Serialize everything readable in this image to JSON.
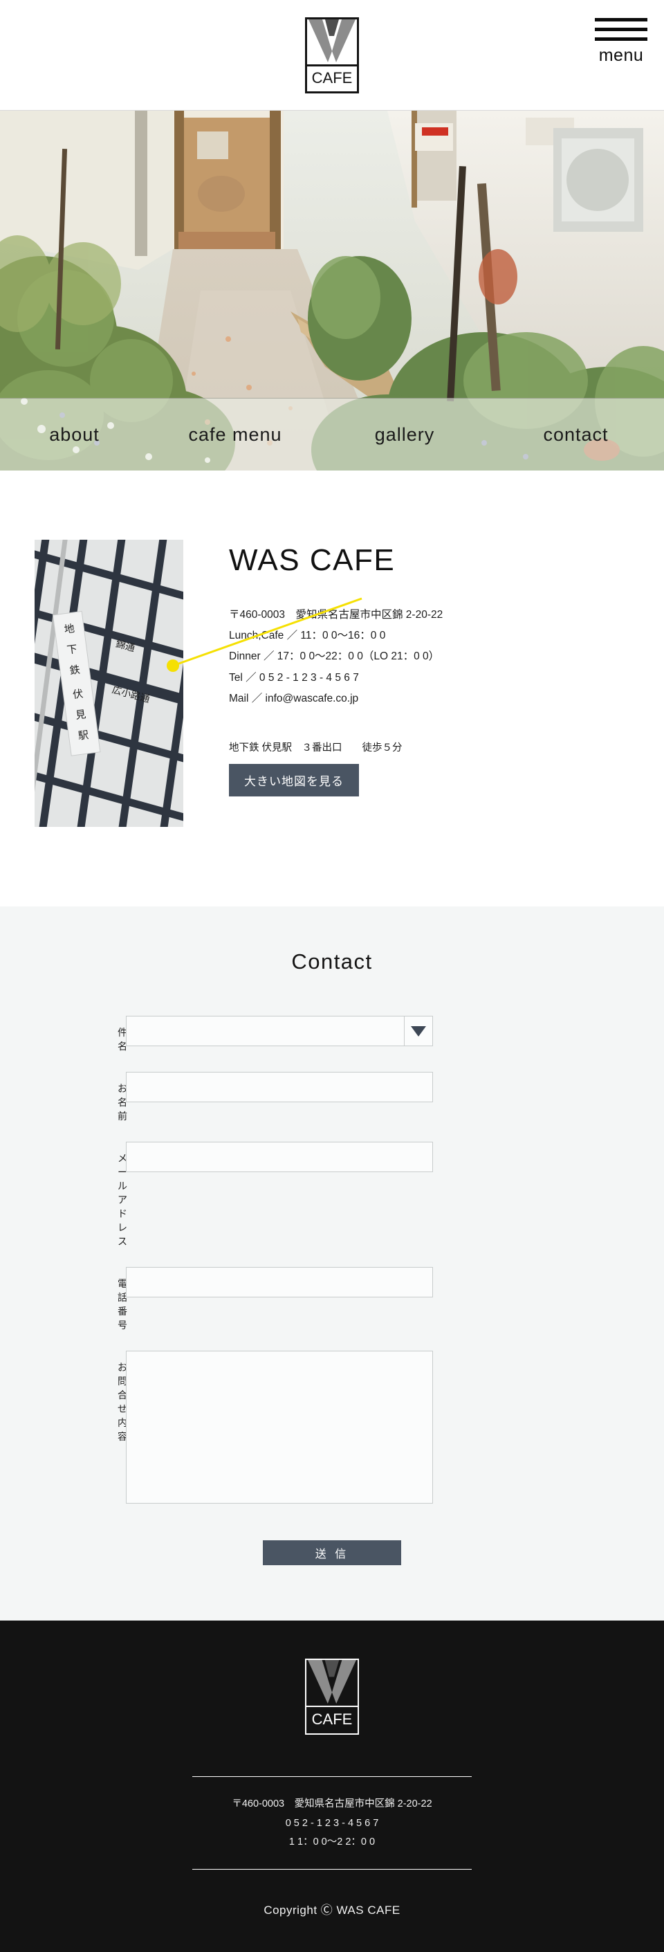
{
  "header": {
    "logo": {
      "mark": "W",
      "word": "CAFE",
      "name": "WAS CAFE logo"
    },
    "menu_button": {
      "label": "menu",
      "icon": "hamburger-icon"
    }
  },
  "hero": {
    "image_alt": "garden path leading to cafe entrance",
    "nav": [
      {
        "label": "about"
      },
      {
        "label": "cafe menu"
      },
      {
        "label": "gallery"
      },
      {
        "label": "contact"
      }
    ]
  },
  "map": {
    "station_label": "地下鉄 伏見駅",
    "street_labels": [
      "錦通",
      "広小路通"
    ],
    "marker_color": "#f5e003"
  },
  "info": {
    "title": "WAS CAFE",
    "lines": [
      "〒460-0003　愛知県名古屋市中区錦 2-20-22",
      "Lunch,Cafe ／ 11：0 0〜16：0 0",
      "Dinner ／ 17：0 0〜22：0 0（LO 21：0 0）",
      "Tel ／ 0 5 2 - 1 2 3 - 4 5 6 7",
      "Mail ／ info@wascafe.co.jp"
    ],
    "access": "地下鉄 伏見駅　３番出口　　徒歩５分",
    "map_button": "大きい地図を見る"
  },
  "contact": {
    "heading": "Contact",
    "fields": [
      {
        "label": "件名",
        "type": "select",
        "value": "",
        "placeholder": ""
      },
      {
        "label": "お名前",
        "type": "text",
        "value": "",
        "placeholder": ""
      },
      {
        "label": "メールアドレス",
        "type": "text",
        "value": "",
        "placeholder": ""
      },
      {
        "label": "電話番号",
        "type": "text",
        "value": "",
        "placeholder": ""
      },
      {
        "label": "お問合せ内容",
        "type": "textarea",
        "value": "",
        "placeholder": ""
      }
    ],
    "submit_label": "送 信"
  },
  "footer": {
    "logo": {
      "mark": "W",
      "word": "CAFE"
    },
    "info_lines": [
      "〒460-0003　愛知県名古屋市中区錦 2-20-22",
      "0 5 2 - 1 2 3 - 4 5 6 7",
      "1 1：0 0〜2 2：0 0"
    ],
    "copyright": "Copyright Ⓒ WAS CAFE"
  },
  "colors": {
    "accent_dark": "#4a5563",
    "footer_bg": "#131313",
    "contact_bg": "#f4f6f6",
    "marker_yellow": "#f5e003"
  }
}
